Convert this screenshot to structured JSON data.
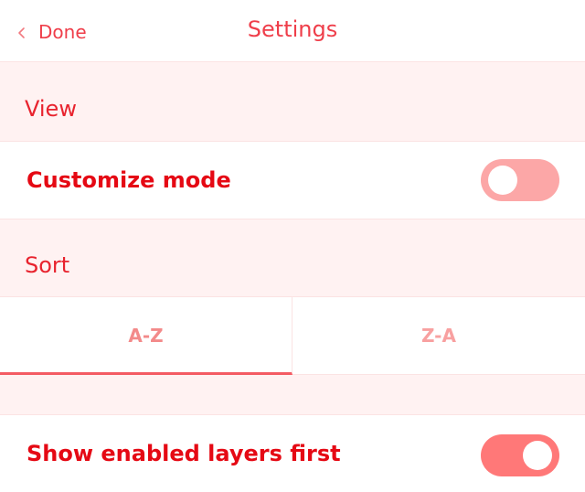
{
  "navbar": {
    "back_label": "Done",
    "title": "Settings"
  },
  "sections": {
    "view": {
      "title": "View",
      "customize_mode_label": "Customize mode",
      "customize_mode_enabled": false
    },
    "sort": {
      "title": "Sort",
      "options": [
        "A-Z",
        "Z-A"
      ],
      "selected": "A-Z",
      "show_enabled_first_label": "Show enabled layers first",
      "show_enabled_first_enabled": true
    }
  },
  "colors": {
    "accent": "#e50914",
    "header_bg": "#fff2f2",
    "toggle_off": "#fca7a7",
    "toggle_on": "#ff7878"
  }
}
